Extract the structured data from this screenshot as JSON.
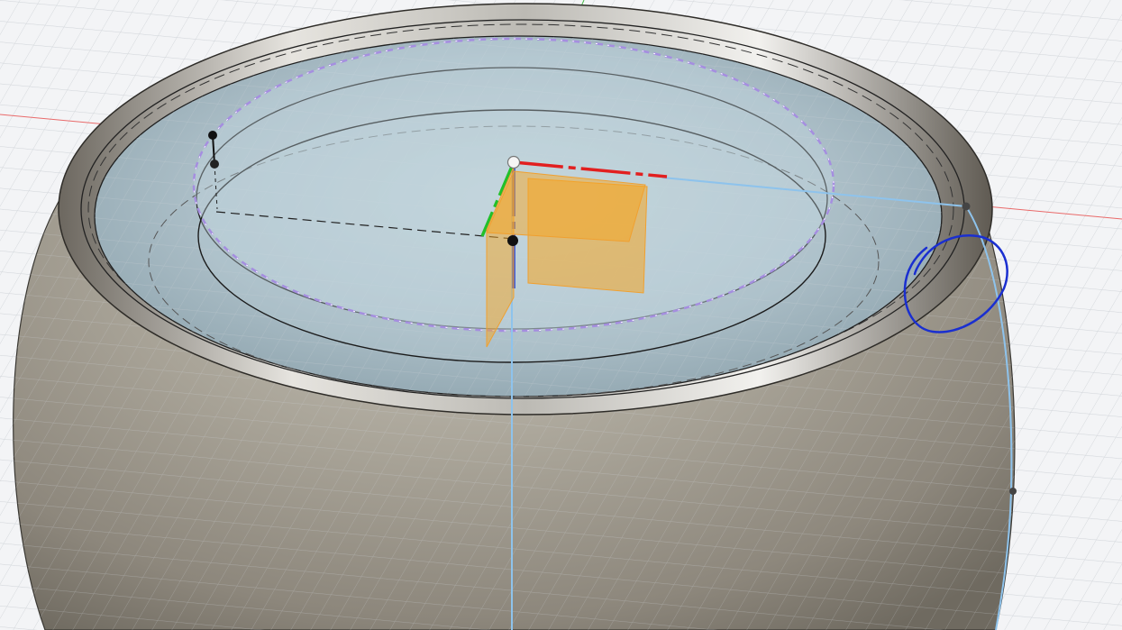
{
  "viewport": {
    "label": "",
    "background": "#f3f4f6",
    "grid_color": "#cfd3d8",
    "grid_major_color": "#b9bec5"
  },
  "axes": {
    "x_color": "#e23a3a",
    "y_color": "#3bb83b",
    "z_color": "#2b55d9",
    "x_axis_name": "x-axis",
    "y_axis_name": "y-axis",
    "z_axis_name": "z-axis"
  },
  "model": {
    "body_color": "#a8a397",
    "body_shadow": "#6f6a60",
    "rim_color": "#d7d7d2",
    "inner_face_color": "#b9cfd8",
    "selected_edge_color": "#8fc6ee",
    "sketch_profile_color": "#b9a6e6"
  },
  "gizmo": {
    "plane_color": "#f5a623",
    "plane_opacity": 0.55
  },
  "annotation": {
    "shape": "hand-drawn-circle",
    "color": "#1a2fd0"
  }
}
